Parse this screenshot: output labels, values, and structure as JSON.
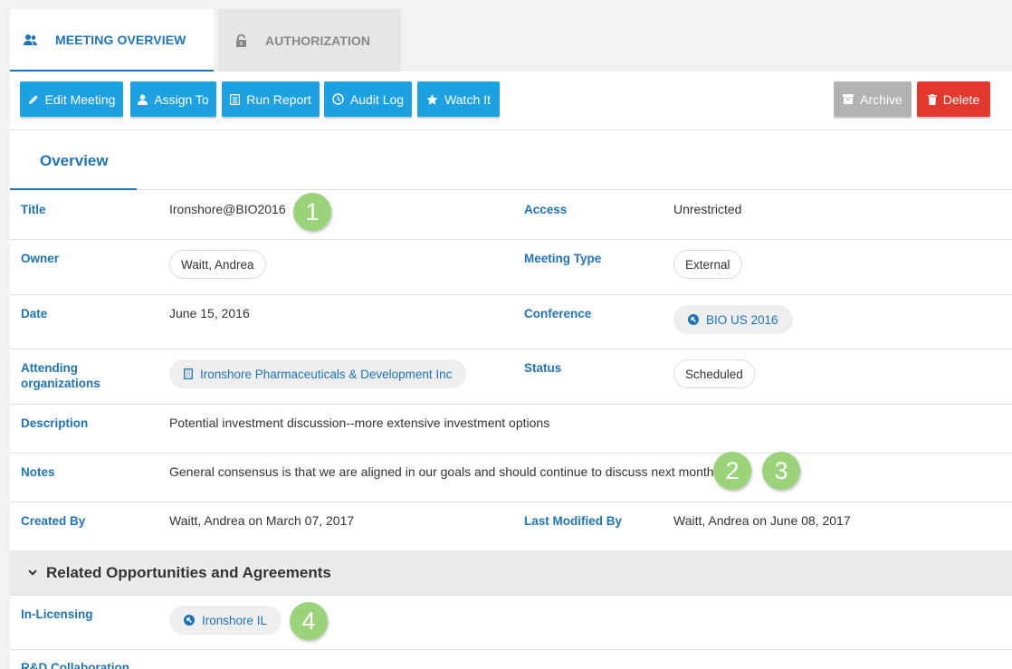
{
  "tabs": [
    {
      "label": "MEETING OVERVIEW",
      "icon": "users-icon",
      "active": true
    },
    {
      "label": "AUTHORIZATION",
      "icon": "lock-icon",
      "active": false
    }
  ],
  "toolbar": {
    "edit_label": "Edit Meeting",
    "assign_label": "Assign To",
    "report_label": "Run Report",
    "audit_label": "Audit Log",
    "watch_label": "Watch It",
    "archive_label": "Archive",
    "delete_label": "Delete"
  },
  "subtab": {
    "label": "Overview"
  },
  "fields": {
    "title": {
      "label": "Title",
      "value": "Ironshore@BIO2016"
    },
    "access": {
      "label": "Access",
      "value": "Unrestricted"
    },
    "owner": {
      "label": "Owner",
      "value": "Waitt, Andrea"
    },
    "meeting_type": {
      "label": "Meeting Type",
      "value": "External"
    },
    "date": {
      "label": "Date",
      "value": "June 15, 2016"
    },
    "conference": {
      "label": "Conference",
      "value": "BIO US 2016"
    },
    "attending": {
      "label_line1": "Attending",
      "label_line2": "organizations",
      "value": "Ironshore Pharmaceuticals & Development Inc"
    },
    "status": {
      "label": "Status",
      "value": "Scheduled"
    },
    "description": {
      "label": "Description",
      "value": "Potential investment discussion--more extensive investment options"
    },
    "notes": {
      "label": "Notes",
      "value": "General consensus is that we are aligned in our goals and should continue to discuss next month."
    },
    "created_by": {
      "label": "Created By",
      "value": "Waitt, Andrea on March 07, 2017"
    },
    "last_modified_by": {
      "label": "Last Modified By",
      "value": "Waitt, Andrea on June 08, 2017"
    }
  },
  "related": {
    "heading": "Related Opportunities and Agreements",
    "in_licensing": {
      "label": "In-Licensing",
      "value": "Ironshore IL"
    },
    "rd_collaboration": {
      "label": "R&D Collaboration"
    }
  },
  "badges": [
    "1",
    "2",
    "3",
    "4"
  ],
  "colors": {
    "accent": "#1f74b8",
    "button_blue": "#1da1e2",
    "button_gray": "#b3b3b3",
    "button_red": "#e2382d",
    "badge_green": "#9bd37b"
  }
}
